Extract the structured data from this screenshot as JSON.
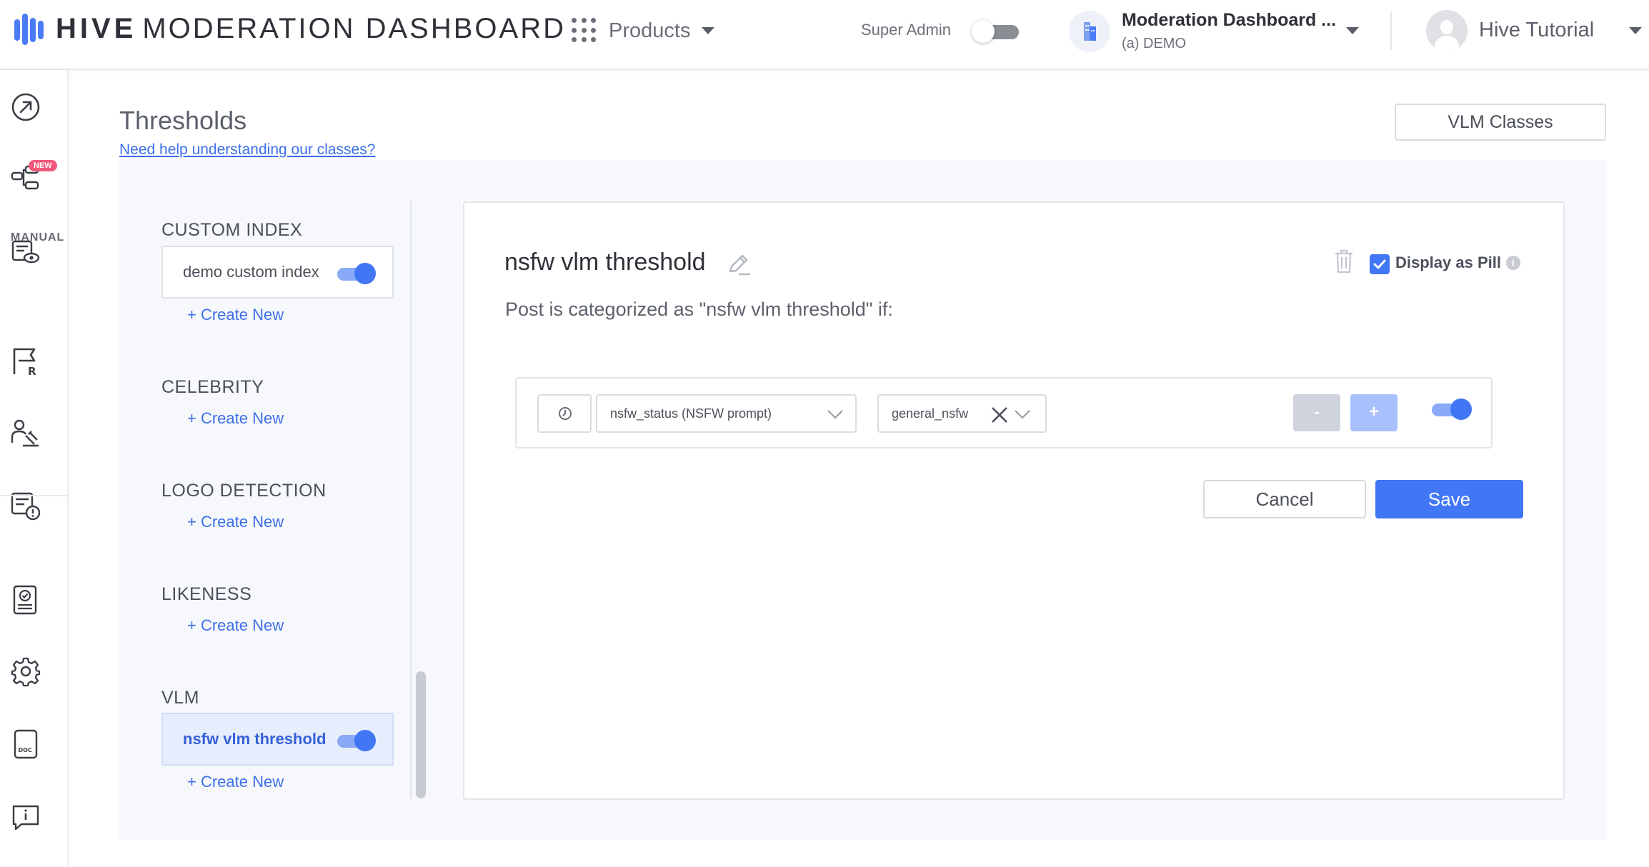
{
  "header": {
    "brand_bold": "HIVE",
    "brand_rest": "MODERATION DASHBOARD",
    "products_label": "Products",
    "super_admin_label": "Super Admin",
    "org_name": "Moderation Dashboard ...",
    "org_sub": "(a) DEMO",
    "user_name": "Hive Tutorial"
  },
  "sidebar": {
    "new_badge": "NEW",
    "manual_label": "MANUAL",
    "icons": [
      "dashboard-arrow-icon",
      "workflow-icon",
      "review-eye-icon",
      "flag-review-icon",
      "moderator-icon",
      "report-alert-icon",
      "checklist-icon",
      "settings-gear-icon",
      "doc-icon",
      "feedback-icon"
    ]
  },
  "page": {
    "title": "Thresholds",
    "help_link": "Need help understanding our classes?",
    "vlm_classes_button": "VLM Classes"
  },
  "sections": [
    {
      "title": "CUSTOM INDEX",
      "items": [
        {
          "name": "demo custom index",
          "enabled": true,
          "selected": false
        }
      ],
      "create_label": "+ Create New"
    },
    {
      "title": "CELEBRITY",
      "items": [],
      "create_label": "+ Create New"
    },
    {
      "title": "LOGO DETECTION",
      "items": [],
      "create_label": "+ Create New"
    },
    {
      "title": "LIKENESS",
      "items": [],
      "create_label": "+ Create New"
    },
    {
      "title": "VLM",
      "items": [
        {
          "name": "nsfw vlm threshold",
          "enabled": true,
          "selected": true
        }
      ],
      "create_label": "+ Create New"
    }
  ],
  "editor": {
    "title": "nsfw vlm threshold",
    "subtitle": "Post is categorized as \"nsfw vlm threshold\" if:",
    "display_as_pill_label": "Display as Pill",
    "display_as_pill_checked": true,
    "info_glyph": "i",
    "condition": {
      "field_select": "nsfw_status (NSFW prompt)",
      "value_tag": "general_nsfw",
      "minus_label": "-",
      "plus_label": "+",
      "enabled": true
    },
    "cancel_label": "Cancel",
    "save_label": "Save"
  },
  "colors": {
    "accent": "#4176f4",
    "link": "#3d6fe8",
    "new_badge": "#f2587a"
  }
}
